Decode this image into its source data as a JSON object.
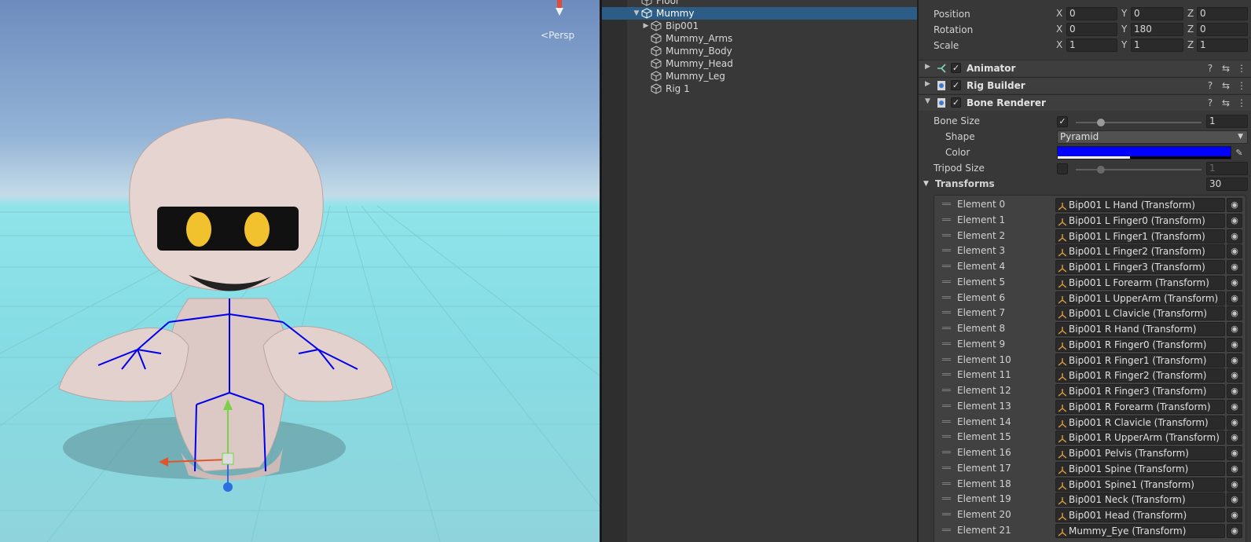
{
  "scene": {
    "view_mode_label": "Persp",
    "gizmo_icon": "scene-orientation-gizmo"
  },
  "hierarchy": {
    "items": [
      {
        "label": "Floor",
        "expander": "",
        "icon": "gameobject-cube-icon"
      },
      {
        "label": "Mummy",
        "expander": "▼",
        "icon": "gameobject-cube-icon",
        "selected": true
      },
      {
        "label": "Bip001",
        "expander": "▶",
        "icon": "gameobject-cube-icon"
      },
      {
        "label": "Mummy_Arms",
        "expander": "",
        "icon": "gameobject-cube-icon"
      },
      {
        "label": "Mummy_Body",
        "expander": "",
        "icon": "gameobject-cube-icon"
      },
      {
        "label": "Mummy_Head",
        "expander": "",
        "icon": "gameobject-cube-icon"
      },
      {
        "label": "Mummy_Leg",
        "expander": "",
        "icon": "gameobject-cube-icon"
      },
      {
        "label": "Rig 1",
        "expander": "",
        "icon": "gameobject-cube-icon"
      }
    ]
  },
  "inspector": {
    "transform": {
      "position": {
        "label": "Position",
        "x": "0",
        "y": "0",
        "z": "0"
      },
      "rotation": {
        "label": "Rotation",
        "x": "0",
        "y": "180",
        "z": "0"
      },
      "scale": {
        "label": "Scale",
        "x": "1",
        "y": "1",
        "z": "1"
      },
      "axis_x": "X",
      "axis_y": "Y",
      "axis_z": "Z"
    },
    "components": [
      {
        "name": "Animator",
        "fold": "▶",
        "check": "✓",
        "icon": "animator-icon"
      },
      {
        "name": "Rig Builder",
        "fold": "▶",
        "check": "✓",
        "icon": "script-icon"
      },
      {
        "name": "Bone Renderer",
        "fold": "▼",
        "check": "✓",
        "icon": "script-icon"
      }
    ],
    "header_icons": {
      "help": "?",
      "presets": "⇆",
      "menu": "⋮"
    },
    "bone_renderer": {
      "bone_size": {
        "label": "Bone Size",
        "checked": "✓",
        "value": "1",
        "slider_fraction": 0.2
      },
      "shape": {
        "label": "Shape",
        "value": "Pyramid"
      },
      "color": {
        "label": "Color",
        "hex": "#0000ff",
        "alpha_fraction": 0.42
      },
      "tripod_size": {
        "label": "Tripod Size",
        "checked": "",
        "value": "1",
        "slider_fraction": 0.2
      },
      "transforms": {
        "label": "Transforms",
        "count": "30",
        "fold": "▼"
      }
    },
    "elements": [
      {
        "label": "Element 0",
        "value": "Bip001 L Hand (Transform)"
      },
      {
        "label": "Element 1",
        "value": "Bip001 L Finger0 (Transform)"
      },
      {
        "label": "Element 2",
        "value": "Bip001 L Finger1 (Transform)"
      },
      {
        "label": "Element 3",
        "value": "Bip001 L Finger2 (Transform)"
      },
      {
        "label": "Element 4",
        "value": "Bip001 L Finger3 (Transform)"
      },
      {
        "label": "Element 5",
        "value": "Bip001 L Forearm (Transform)"
      },
      {
        "label": "Element 6",
        "value": "Bip001 L UpperArm (Transform)"
      },
      {
        "label": "Element 7",
        "value": "Bip001 L Clavicle (Transform)"
      },
      {
        "label": "Element 8",
        "value": "Bip001 R Hand (Transform)"
      },
      {
        "label": "Element 9",
        "value": "Bip001 R Finger0 (Transform)"
      },
      {
        "label": "Element 10",
        "value": "Bip001 R Finger1 (Transform)"
      },
      {
        "label": "Element 11",
        "value": "Bip001 R Finger2 (Transform)"
      },
      {
        "label": "Element 12",
        "value": "Bip001 R Finger3 (Transform)"
      },
      {
        "label": "Element 13",
        "value": "Bip001 R Forearm (Transform)"
      },
      {
        "label": "Element 14",
        "value": "Bip001 R Clavicle (Transform)"
      },
      {
        "label": "Element 15",
        "value": "Bip001 R UpperArm (Transform)"
      },
      {
        "label": "Element 16",
        "value": "Bip001 Pelvis (Transform)"
      },
      {
        "label": "Element 17",
        "value": "Bip001 Spine (Transform)"
      },
      {
        "label": "Element 18",
        "value": "Bip001 Spine1 (Transform)"
      },
      {
        "label": "Element 19",
        "value": "Bip001 Neck (Transform)"
      },
      {
        "label": "Element 20",
        "value": "Bip001 Head (Transform)"
      },
      {
        "label": "Element 21",
        "value": "Mummy_Eye (Transform)"
      }
    ],
    "element_picker_icon": "object-picker-icon",
    "element_drag_icon": "drag-handle-icon"
  },
  "colors": {
    "selection": "#2c5d87",
    "bone_color": "#0000ff",
    "panel_bg": "#383838"
  }
}
